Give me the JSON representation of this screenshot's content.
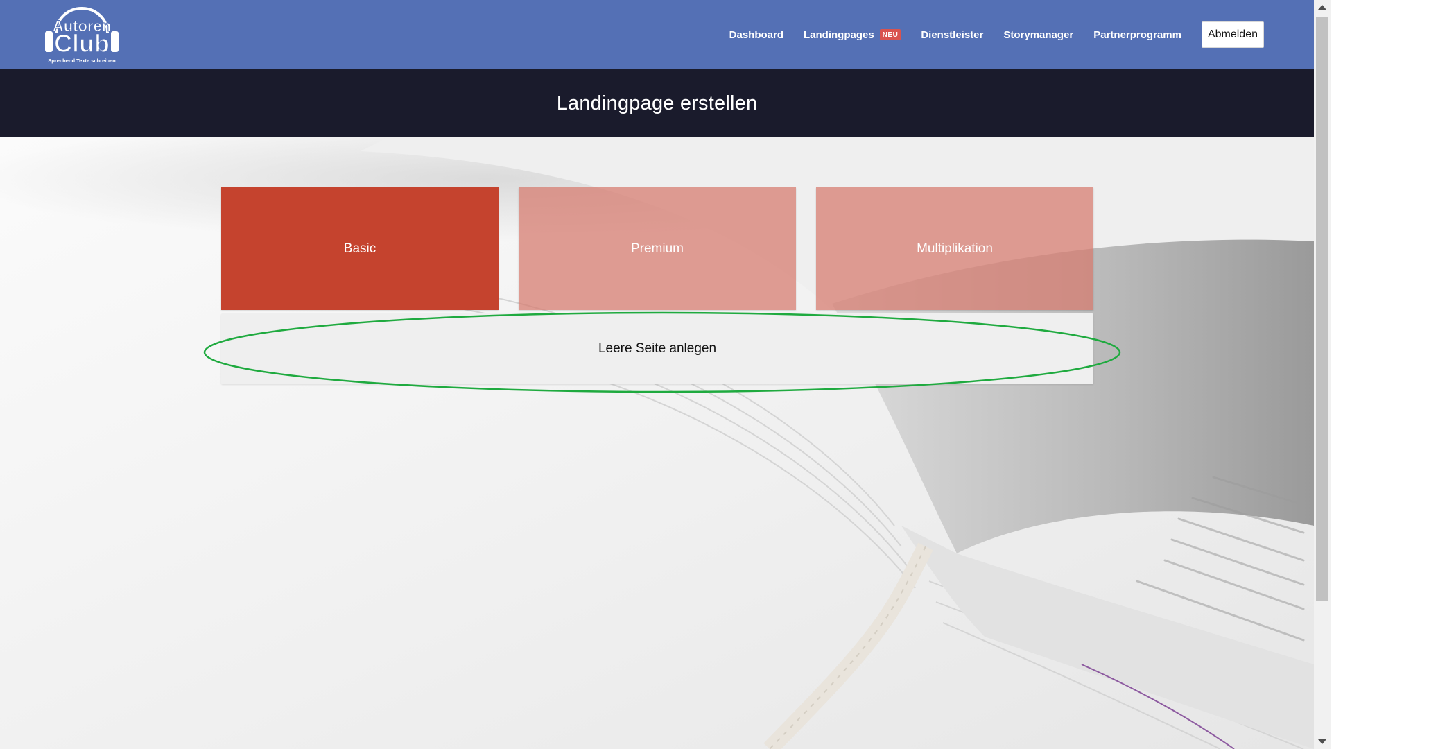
{
  "logo": {
    "line1": "Autoren",
    "line2": "Club",
    "tagline": "Sprechend Texte schreiben"
  },
  "nav": {
    "items": [
      {
        "label": "Dashboard"
      },
      {
        "label": "Landingpages",
        "badge": "NEU"
      },
      {
        "label": "Dienstleister"
      },
      {
        "label": "Storymanager"
      },
      {
        "label": "Partnerprogramm"
      }
    ],
    "logout_label": "Abmelden"
  },
  "page": {
    "title": "Landingpage erstellen"
  },
  "templates": [
    {
      "label": "Basic"
    },
    {
      "label": "Premium"
    },
    {
      "label": "Multiplikation"
    }
  ],
  "empty_page_label": "Leere Seite anlegen",
  "colors": {
    "nav_bg": "#5470b5",
    "title_band_bg": "#1a1b2c",
    "basic_card": "#c5432e",
    "other_cards": "#d6786c",
    "badge": "#d9534f",
    "highlight": "#1faa3f"
  },
  "icons": {
    "scroll_up": "triangle-up",
    "scroll_down": "triangle-down"
  }
}
